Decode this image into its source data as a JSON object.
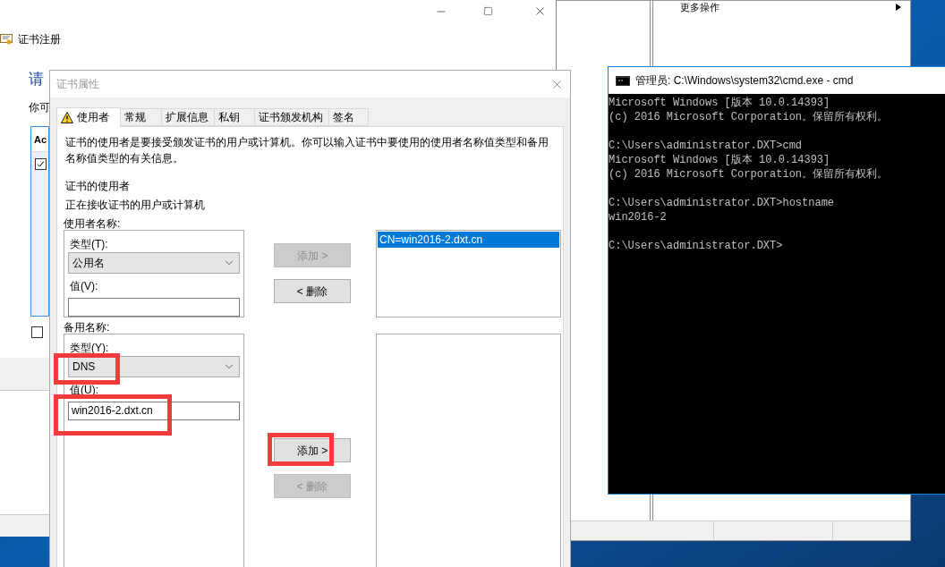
{
  "mmc_window": {
    "actions_item": "更多操作"
  },
  "enroll_window": {
    "title": "证书注册",
    "heading": "请",
    "intro": "你可",
    "list_header": "Ac",
    "list_item_checked": true,
    "bottom_checkbox_checked": false
  },
  "dialog": {
    "title": "证书属性",
    "tabs": [
      {
        "label": "使用者",
        "selected": true,
        "warning": true
      },
      {
        "label": "常规",
        "selected": false,
        "warning": false
      },
      {
        "label": "扩展信息",
        "selected": false,
        "warning": false
      },
      {
        "label": "私钥",
        "selected": false,
        "warning": false
      },
      {
        "label": "证书颁发机构",
        "selected": false,
        "warning": false
      },
      {
        "label": "签名",
        "selected": false,
        "warning": false
      }
    ],
    "description": "证书的使用者是要接受颁发证书的用户或计算机。你可以输入证书中要使用的使用者名称值类型和备用名称值类型的有关信息。",
    "subject_heading": "证书的使用者",
    "subject_hint": "正在接收证书的用户或计算机",
    "sections": [
      {
        "label": "使用者名称:",
        "type_label": "类型(T):",
        "type_value": "公用名",
        "type_highlighted": false,
        "value_label": "值(V):",
        "value_highlighted": false,
        "buttons": [
          {
            "label": "添加 >",
            "disabled": true,
            "highlighted": false
          },
          {
            "label": "< 删除",
            "disabled": false,
            "highlighted": false
          }
        ],
        "list": [
          {
            "text": "CN=win2016-2.dxt.cn",
            "selected": true
          }
        ]
      },
      {
        "label": "备用名称:",
        "type_label": "类型(Y):",
        "type_value": "DNS",
        "type_highlighted": true,
        "value_label": "值(U):",
        "value": "win2016-2.dxt.cn",
        "value_highlighted": true,
        "buttons": [
          {
            "label": "添加 >",
            "disabled": false,
            "highlighted": true
          },
          {
            "label": "< 删除",
            "disabled": true,
            "highlighted": false
          }
        ]
      }
    ]
  },
  "cmd": {
    "title": "管理员: C:\\Windows\\system32\\cmd.exe - cmd",
    "blocks": [
      [
        "Microsoft Windows [版本 10.0.14393]",
        "(c) 2016 Microsoft Corporation。保留所有权利。"
      ],
      [
        "C:\\Users\\administrator.DXT>cmd",
        "Microsoft Windows [版本 10.0.14393]",
        "(c) 2016 Microsoft Corporation。保留所有权利。"
      ],
      [
        "C:\\Users\\administrator.DXT>hostname",
        "win2016-2"
      ],
      [
        "C:\\Users\\administrator.DXT>"
      ]
    ]
  }
}
